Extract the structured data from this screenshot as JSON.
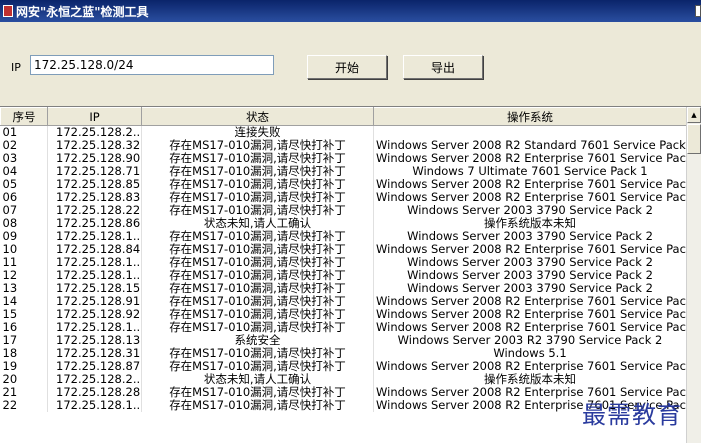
{
  "window": {
    "title": "网安\"永恒之蓝\"检测工具"
  },
  "toolbar": {
    "ip_label": "IP",
    "ip_value": "172.25.128.0/24",
    "start_label": "开始",
    "export_label": "导出"
  },
  "table": {
    "headers": [
      "序号",
      "IP",
      "状态",
      "操作系统"
    ],
    "rows": [
      [
        "01",
        "172.25.128.2...",
        "连接失败",
        ""
      ],
      [
        "02",
        "172.25.128.32",
        "存在MS17-010漏洞,请尽快打补丁",
        "Windows Server 2008 R2 Standard 7601 Service Pack 1"
      ],
      [
        "03",
        "172.25.128.90",
        "存在MS17-010漏洞,请尽快打补丁",
        "Windows Server 2008 R2 Enterprise 7601 Service Pack 1"
      ],
      [
        "04",
        "172.25.128.71",
        "存在MS17-010漏洞,请尽快打补丁",
        "Windows 7 Ultimate 7601 Service Pack 1"
      ],
      [
        "05",
        "172.25.128.85",
        "存在MS17-010漏洞,请尽快打补丁",
        "Windows Server 2008 R2 Enterprise 7601 Service Pack 1"
      ],
      [
        "06",
        "172.25.128.83",
        "存在MS17-010漏洞,请尽快打补丁",
        "Windows Server 2008 R2 Enterprise 7601 Service Pack 1"
      ],
      [
        "07",
        "172.25.128.22",
        "存在MS17-010漏洞,请尽快打补丁",
        "Windows Server 2003 3790 Service Pack 2"
      ],
      [
        "08",
        "172.25.128.86",
        "状态未知,请人工确认",
        "操作系统版本未知"
      ],
      [
        "09",
        "172.25.128.1...",
        "存在MS17-010漏洞,请尽快打补丁",
        "Windows Server 2003 3790 Service Pack 2"
      ],
      [
        "10",
        "172.25.128.84",
        "存在MS17-010漏洞,请尽快打补丁",
        "Windows Server 2008 R2 Enterprise 7601 Service Pack 1"
      ],
      [
        "11",
        "172.25.128.1...",
        "存在MS17-010漏洞,请尽快打补丁",
        "Windows Server 2003 3790 Service Pack 2"
      ],
      [
        "12",
        "172.25.128.1...",
        "存在MS17-010漏洞,请尽快打补丁",
        "Windows Server 2003 3790 Service Pack 2"
      ],
      [
        "13",
        "172.25.128.15",
        "存在MS17-010漏洞,请尽快打补丁",
        "Windows Server 2003 3790 Service Pack 2"
      ],
      [
        "14",
        "172.25.128.91",
        "存在MS17-010漏洞,请尽快打补丁",
        "Windows Server 2008 R2 Enterprise 7601 Service Pack 1"
      ],
      [
        "15",
        "172.25.128.92",
        "存在MS17-010漏洞,请尽快打补丁",
        "Windows Server 2008 R2 Enterprise 7601 Service Pack 1"
      ],
      [
        "16",
        "172.25.128.1...",
        "存在MS17-010漏洞,请尽快打补丁",
        "Windows Server 2008 R2 Enterprise 7601 Service Pack 1"
      ],
      [
        "17",
        "172.25.128.13",
        "系统安全",
        "Windows Server 2003 R2 3790 Service Pack 2"
      ],
      [
        "18",
        "172.25.128.31",
        "存在MS17-010漏洞,请尽快打补丁",
        "Windows 5.1"
      ],
      [
        "19",
        "172.25.128.87",
        "存在MS17-010漏洞,请尽快打补丁",
        "Windows Server 2008 R2 Enterprise 7601 Service Pack 1"
      ],
      [
        "20",
        "172.25.128.2...",
        "状态未知,请人工确认",
        "操作系统版本未知"
      ],
      [
        "21",
        "172.25.128.28",
        "存在MS17-010漏洞,请尽快打补丁",
        "Windows Server 2008 R2 Enterprise 7601 Service Pack 1"
      ],
      [
        "22",
        "172.25.128.1...",
        "存在MS17-010漏洞,请尽快打补丁",
        "Windows Server 2008 R2 Enterprise 7601 Service Pack 1"
      ]
    ]
  },
  "watermark": "最需教育"
}
